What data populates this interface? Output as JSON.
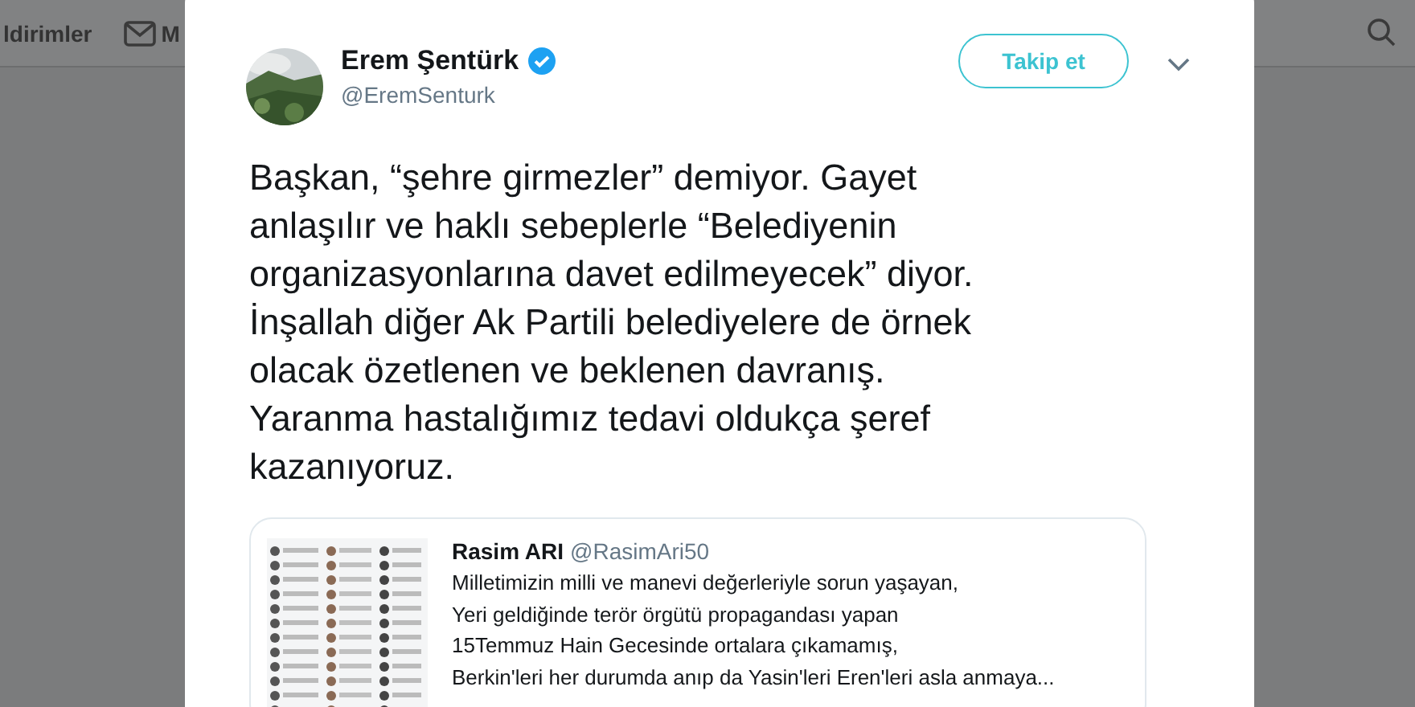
{
  "background_nav": {
    "items": [
      {
        "label": "ldirimler",
        "kind": "plain"
      },
      {
        "label": "M",
        "kind": "mail"
      }
    ]
  },
  "tweet": {
    "author": {
      "name": "Erem Şentürk",
      "handle": "@EremSenturk",
      "verified": true
    },
    "follow_button": "Takip et",
    "text_lines": [
      "Başkan, “şehre girmezler” demiyor. Gayet",
      "anlaşılır ve haklı sebeplerle “Belediyenin",
      "organizasyonlarına davet edilmeyecek” diyor.",
      "İnşallah diğer Ak Partili belediyelere de örnek",
      "olacak özetlenen ve beklenen davranış.",
      "Yaranma hastalığımız tedavi oldukça şeref",
      "kazanıyoruz."
    ],
    "quote": {
      "name": "Rasim ARI",
      "handle": "@RasimAri50",
      "lines": [
        "Milletimizin milli ve manevi değerleriyle sorun yaşayan,",
        "Yeri geldiğinde terör örgütü propagandası yapan",
        "15Temmuz Hain Gecesinde ortalara çıkamamış,",
        "Berkin'leri her durumda anıp da Yasin'leri Eren'leri asla anmaya..."
      ]
    }
  }
}
